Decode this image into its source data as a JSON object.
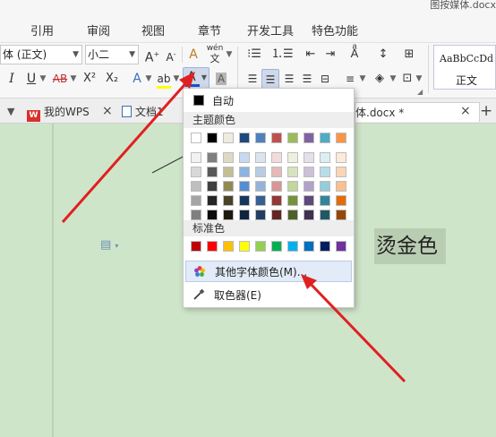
{
  "window": {
    "title": "图按媒体.docx"
  },
  "menu": {
    "items": [
      "引用",
      "审阅",
      "视图",
      "章节",
      "开发工具",
      "特色功能"
    ]
  },
  "ribbon": {
    "font_name": "体 (正文)",
    "font_size": "小二",
    "grow_font_label": "A",
    "shrink_font_label": "A",
    "clear_format_label": "A",
    "pinyin_label": "wén",
    "italic_label": "I",
    "underline_label": "U",
    "strikethrough_label": "AB",
    "superscript_label": "X²",
    "subscript_label": "X₂",
    "text_effect_label": "A",
    "highlight_label": "ab",
    "font_color_label": "A",
    "char_shading_label": "A",
    "highlight_color": "#ffff00",
    "font_color": "#1f4fd1",
    "style_sample": "AaBbCcDd",
    "style_name": "正文"
  },
  "tabs": {
    "wps_label": "我的WPS",
    "doc1_label": "文档1",
    "active_label": "体.docx *"
  },
  "document": {
    "text": "烫金色"
  },
  "font_color_menu": {
    "auto_label": "自动",
    "auto_color": "#000000",
    "theme_heading": "主题颜色",
    "theme_colors": [
      [
        "#ffffff",
        "#000000",
        "#eeece1",
        "#1f497d",
        "#4f81bd",
        "#c0504d",
        "#9bbb59",
        "#8064a2",
        "#4bacc6",
        "#f79646"
      ],
      [
        "#f2f2f2",
        "#7f7f7f",
        "#ddd9c3",
        "#c6d9f0",
        "#dbe5f1",
        "#f2dcdb",
        "#ebf1dd",
        "#e5e0ec",
        "#dbeef3",
        "#fdeada"
      ],
      [
        "#d8d8d8",
        "#595959",
        "#c4bd97",
        "#8db3e2",
        "#b8cce4",
        "#e5b9b7",
        "#d7e3bc",
        "#ccc1d9",
        "#b7dde8",
        "#fbd5b5"
      ],
      [
        "#bfbfbf",
        "#3f3f3f",
        "#938953",
        "#548dd4",
        "#95b3d7",
        "#d99694",
        "#c3d69b",
        "#b2a2c7",
        "#92cddc",
        "#fac08f"
      ],
      [
        "#a5a5a5",
        "#262626",
        "#494429",
        "#17365d",
        "#366092",
        "#953734",
        "#76923c",
        "#5f497a",
        "#31859b",
        "#e36c09"
      ],
      [
        "#7f7f7f",
        "#0c0c0c",
        "#1d1b10",
        "#0f243e",
        "#244061",
        "#632423",
        "#4f6128",
        "#3f3151",
        "#205867",
        "#974806"
      ]
    ],
    "standard_heading": "标准色",
    "standard_colors": [
      "#c00000",
      "#ff0000",
      "#ffc000",
      "#ffff00",
      "#92d050",
      "#00b050",
      "#00b0f0",
      "#0070c0",
      "#002060",
      "#7030a0"
    ],
    "more_colors_label": "其他字体颜色(M)...",
    "eyedropper_label": "取色器(E)"
  },
  "annotation_color": "#e02020"
}
